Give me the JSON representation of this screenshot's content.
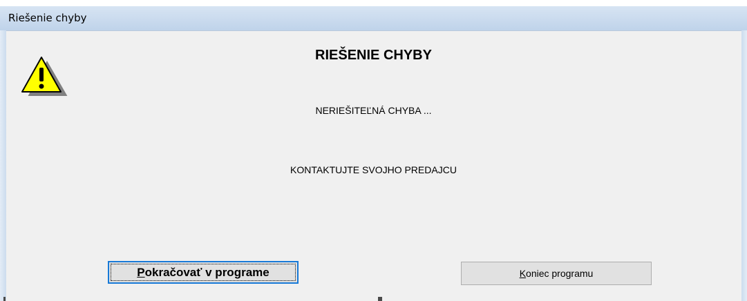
{
  "window": {
    "title": "Riešenie chyby"
  },
  "dialog": {
    "icon": "warning-icon",
    "heading": "RIEŠENIE CHYBY",
    "message_line1": "NERIEŠITEĽNÁ CHYBA ...",
    "message_line2": "KONTAKTUJTE SVOJHO PREDAJCU"
  },
  "buttons": {
    "continue": {
      "label_accel": "P",
      "label_rest": "okračovať v programe"
    },
    "exit": {
      "label_accel": "K",
      "label_rest": "oniec programu"
    }
  },
  "colors": {
    "titlebar": "#c9daee",
    "focus_border": "#1779d7",
    "warning_fill": "#ffff00"
  }
}
